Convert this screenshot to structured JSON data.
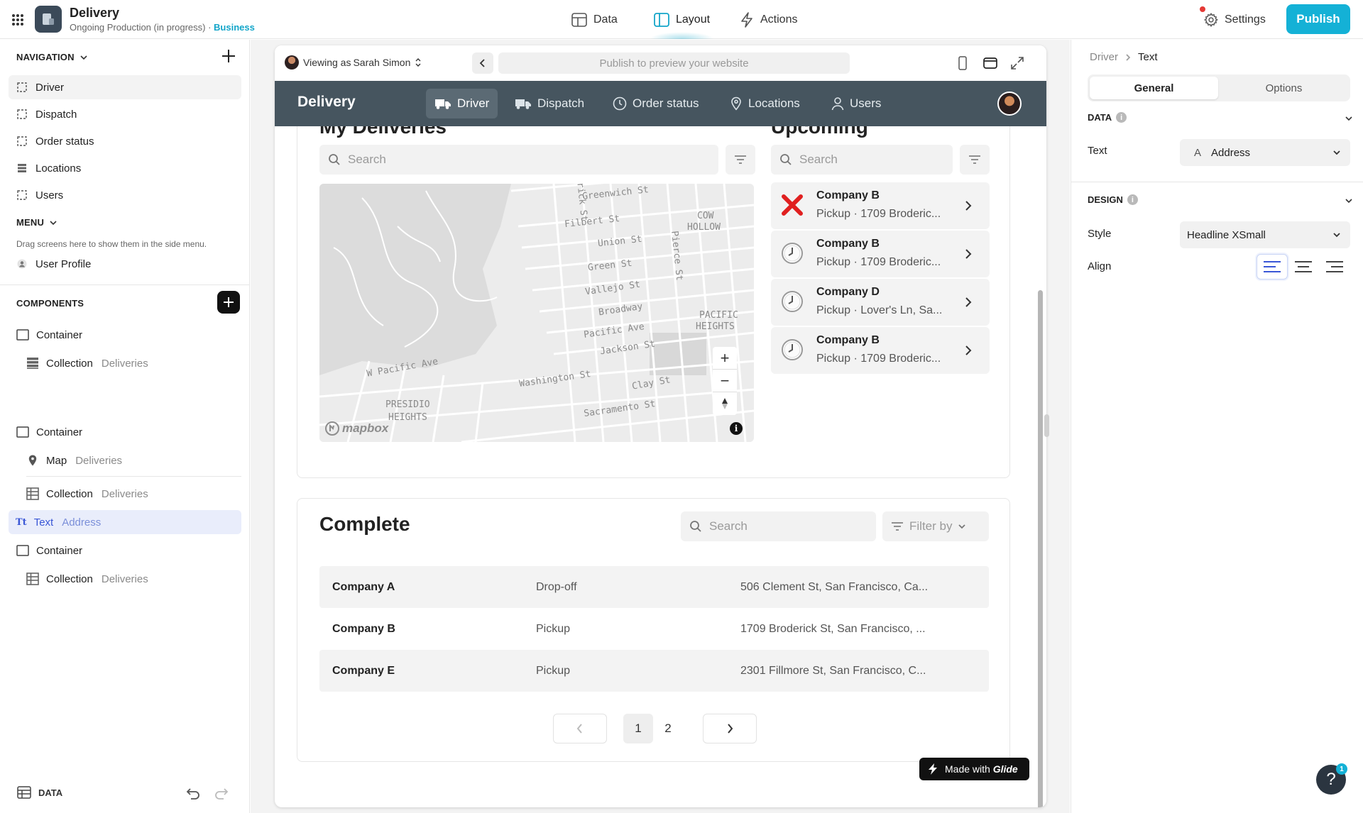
{
  "topbar": {
    "app_title": "Delivery",
    "app_subtitle": "Ongoing Production (in progress) · ",
    "plan": "Business",
    "tabs": [
      {
        "label": "Data",
        "icon": "table-icon"
      },
      {
        "label": "Layout",
        "icon": "layout-icon",
        "active": true
      },
      {
        "label": "Actions",
        "icon": "bolt-icon"
      }
    ],
    "settings_label": "Settings",
    "publish_label": "Publish"
  },
  "left": {
    "navigation_header": "NAVIGATION",
    "nav_items": [
      {
        "label": "Driver",
        "icon": "screen-icon",
        "selected": true
      },
      {
        "label": "Dispatch",
        "icon": "screen-icon"
      },
      {
        "label": "Order status",
        "icon": "screen-icon"
      },
      {
        "label": "Locations",
        "icon": "list-icon"
      },
      {
        "label": "Users",
        "icon": "screen-icon"
      }
    ],
    "menu_header": "MENU",
    "menu_hint": "Drag screens here to show them in the side menu.",
    "menu_items": [
      {
        "label": "User Profile",
        "icon": "user-icon"
      }
    ],
    "components_header": "COMPONENTS",
    "components": [
      {
        "label": "Container",
        "sub": ""
      },
      {
        "label": "Collection",
        "sub": "Deliveries"
      },
      {
        "label": "Container",
        "sub": ""
      },
      {
        "label": "Map",
        "sub": "Deliveries"
      },
      {
        "label": "Collection",
        "sub": "Deliveries"
      },
      {
        "label": "Text",
        "sub": "Address",
        "selected": true
      },
      {
        "label": "Container",
        "sub": ""
      },
      {
        "label": "Collection",
        "sub": "Deliveries"
      }
    ],
    "data_label": "DATA"
  },
  "preview": {
    "viewing_as": "Viewing as ",
    "viewer_name": "Sarah Simon",
    "url_placeholder": "Publish to preview your website",
    "app_name": "Delivery",
    "tabs": [
      "Driver",
      "Dispatch",
      "Order status",
      "Locations",
      "Users"
    ],
    "active_tab": "Driver",
    "my_deliveries_title": "My Deliveries",
    "upcoming_title": "Upcoming",
    "search_placeholder": "Search",
    "map_labels": [
      "Greenwich St",
      "Filbert St",
      "COW",
      "HOLLOW",
      "Union St",
      "Green St",
      "Pierce St",
      "Vallejo St",
      "Broadway",
      "Pacific Ave",
      "PACIFIC",
      "HEIGHTS",
      "Jackson St",
      "W Pacific Ave",
      "Washington St",
      "Clay St",
      "PRESIDIO",
      "HEIGHTS",
      "Sacramento St",
      "erick St"
    ],
    "mapbox_label": "mapbox",
    "upcoming": [
      {
        "company": "Company B",
        "detail": "Pickup · 1709 Broderic...",
        "status": "cancelled"
      },
      {
        "company": "Company B",
        "detail": "Pickup · 1709 Broderic...",
        "status": "pending"
      },
      {
        "company": "Company D",
        "detail": "Pickup · Lover's Ln, Sa...",
        "status": "pending"
      },
      {
        "company": "Company B",
        "detail": "Pickup · 1709 Broderic...",
        "status": "pending"
      }
    ],
    "complete_title": "Complete",
    "filter_label": "Filter by",
    "complete_rows": [
      {
        "company": "Company A",
        "type": "Drop-off",
        "address": "506 Clement St, San Francisco, Ca..."
      },
      {
        "company": "Company B",
        "type": "Pickup",
        "address": "1709 Broderick St, San Francisco, ..."
      },
      {
        "company": "Company E",
        "type": "Pickup",
        "address": "2301 Fillmore St, San Francisco, C..."
      }
    ],
    "pages": [
      "1",
      "2"
    ],
    "current_page": "1",
    "made_with": "Made with ",
    "made_with_brand": "Glide"
  },
  "right": {
    "breadcrumb": [
      "Driver",
      "Text"
    ],
    "tabs": [
      "General",
      "Options"
    ],
    "active_tab": "General",
    "data_header": "DATA",
    "text_label": "Text",
    "text_value": "Address",
    "text_value_icon": "A",
    "design_header": "DESIGN",
    "style_label": "Style",
    "style_value": "Headline XSmall",
    "align_label": "Align",
    "align_options": [
      "left",
      "center",
      "right"
    ],
    "align_selected": "left"
  },
  "help_badge": "1",
  "colors": {
    "accent": "#14b1d6",
    "header": "#46555f",
    "selected": "#e9edfb",
    "cancel": "#e02020"
  }
}
